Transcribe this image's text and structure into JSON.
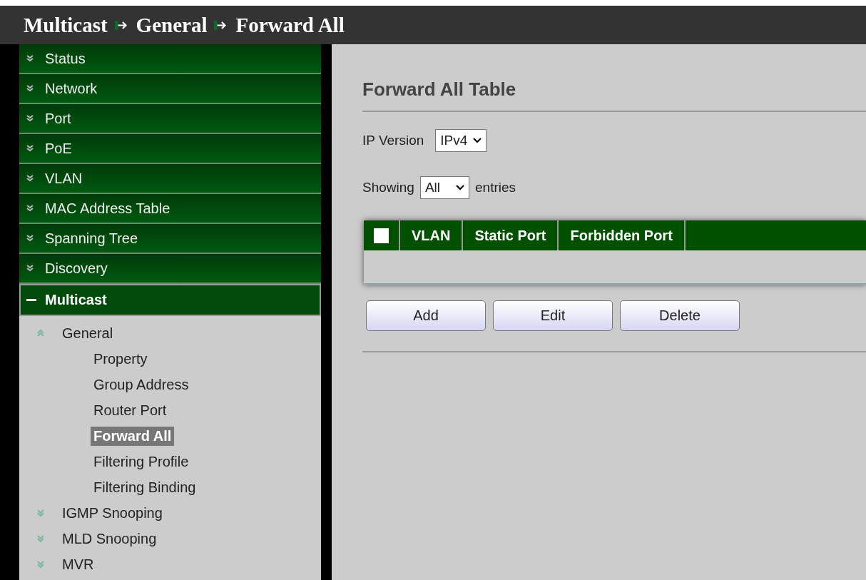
{
  "breadcrumb": [
    "Multicast",
    "General",
    "Forward All"
  ],
  "sidebar": {
    "items": [
      {
        "label": "Status",
        "expanded": false
      },
      {
        "label": "Network",
        "expanded": false
      },
      {
        "label": "Port",
        "expanded": false
      },
      {
        "label": "PoE",
        "expanded": false
      },
      {
        "label": "VLAN",
        "expanded": false
      },
      {
        "label": "MAC Address Table",
        "expanded": false
      },
      {
        "label": "Spanning Tree",
        "expanded": false
      },
      {
        "label": "Discovery",
        "expanded": false
      },
      {
        "label": "Multicast",
        "expanded": true,
        "children": [
          {
            "label": "General",
            "expanded": true,
            "children": [
              {
                "label": "Property",
                "selected": false
              },
              {
                "label": "Group Address",
                "selected": false
              },
              {
                "label": "Router Port",
                "selected": false
              },
              {
                "label": "Forward All",
                "selected": true
              },
              {
                "label": "Filtering Profile",
                "selected": false
              },
              {
                "label": "Filtering Binding",
                "selected": false
              }
            ]
          },
          {
            "label": "IGMP Snooping",
            "expanded": false
          },
          {
            "label": "MLD Snooping",
            "expanded": false
          },
          {
            "label": "MVR",
            "expanded": false
          }
        ]
      }
    ]
  },
  "main": {
    "title": "Forward All Table",
    "ip_version": {
      "label": "IP Version",
      "value": "IPv4"
    },
    "showing": {
      "label": "Showing",
      "value": "All",
      "suffix": "entries"
    },
    "table": {
      "select_all_checked": false,
      "columns": [
        "VLAN",
        "Static Port",
        "Forbidden Port"
      ]
    },
    "buttons": [
      "Add",
      "Edit",
      "Delete"
    ]
  }
}
